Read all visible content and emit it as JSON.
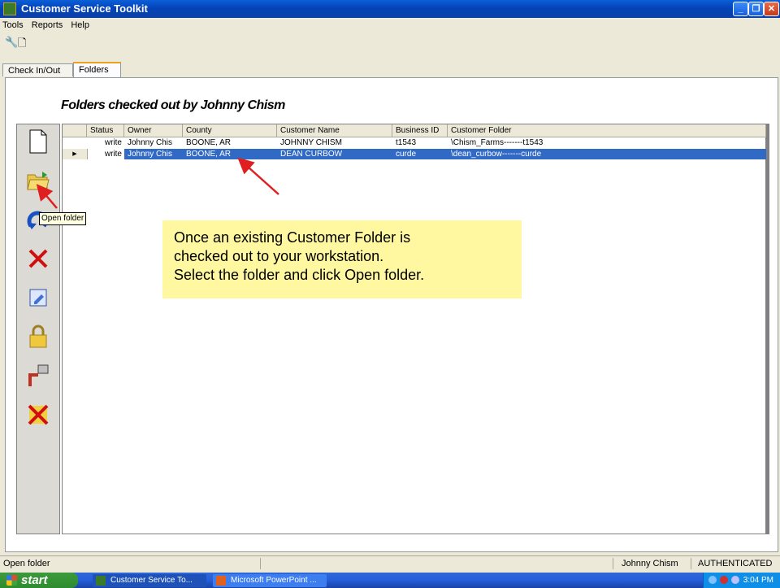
{
  "window": {
    "title": "Customer Service Toolkit"
  },
  "menu": [
    "Tools",
    "Reports",
    "Help"
  ],
  "tabs": [
    "Check In/Out",
    "Folders"
  ],
  "heading": "Folders checked out by Johnny Chism",
  "grid": {
    "columns": [
      "Status",
      "Owner",
      "County",
      "Customer Name",
      "Business ID",
      "Customer Folder"
    ],
    "rows": [
      {
        "status": "write",
        "owner": "Johnny Chis",
        "county": "BOONE, AR",
        "customer": "JOHNNY CHISM",
        "bid": "t1543",
        "folder": "\\Chism_Farms-------t1543",
        "selected": false
      },
      {
        "status": "write",
        "owner": "Johnny Chis",
        "county": "BOONE, AR",
        "customer": "DEAN CURBOW",
        "bid": "curde",
        "folder": "\\dean_curbow-------curde",
        "selected": true
      }
    ]
  },
  "sidebar_icons": [
    "new-document-icon",
    "open-folder-icon",
    "undo-arrow-icon",
    "delete-x-icon",
    "edit-document-icon",
    "padlock-icon",
    "export-icon",
    "cancel-x-icon"
  ],
  "tooltip": "Open folder",
  "callout": {
    "line1": "Once an existing Customer Folder is",
    "line2": "checked out to your workstation.",
    "line3": "Select the folder and click Open folder."
  },
  "status": {
    "message": "Open folder",
    "user": "Johnny Chism",
    "auth": "AUTHENTICATED"
  },
  "taskbar": {
    "start": "start",
    "tasks": [
      "Customer Service To...",
      "Microsoft PowerPoint ..."
    ],
    "clock": "3:04 PM"
  },
  "colors": {
    "titlebar": "#0a5fd8",
    "selection": "#316ac5",
    "callout": "#fff8a0",
    "arrow": "#e02020"
  }
}
